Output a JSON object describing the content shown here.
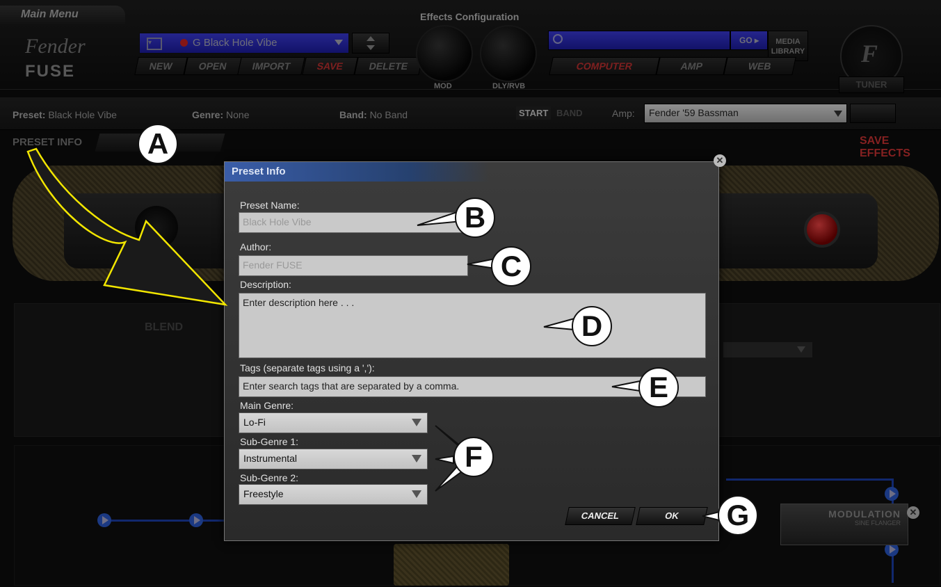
{
  "header": {
    "main_menu": "Main Menu",
    "logo_script": "Fender",
    "logo_word": "FUSE",
    "preset_select": "G Black Hole Vibe",
    "buttons": [
      "NEW",
      "OPEN",
      "IMPORT",
      "SAVE",
      "DELETE"
    ],
    "effects_title": "Effects Configuration",
    "knobs": [
      "MOD",
      "DLY/RVB"
    ],
    "go_label": "GO",
    "media_library": "MEDIA LIBRARY",
    "sources": [
      "COMPUTER",
      "AMP",
      "WEB"
    ],
    "tuner": "TUNER"
  },
  "infobar": {
    "preset_label": "Preset:",
    "preset_value": "Black Hole Vibe",
    "genre_label": "Genre:",
    "genre_value": "None",
    "band_label": "Band:",
    "band_value": "No Band",
    "start": "START",
    "band_btn": "BAND",
    "amp_label": "Amp:",
    "amp_value": "Fender '59 Bassman",
    "tab_preset_info": "PRESET INFO",
    "save_effects": "SAVE EFFECTS"
  },
  "background": {
    "blend": "BLEND",
    "modulation": "MODULATION",
    "modulation_sub": "SINE FLANGER"
  },
  "dialog": {
    "title": "Preset Info",
    "preset_name_label": "Preset Name:",
    "preset_name_value": "Black Hole Vibe",
    "author_label": "Author:",
    "author_value": "Fender FUSE",
    "description_label": "Description:",
    "description_placeholder": "Enter description here . . .",
    "tags_label": "Tags (separate tags using a ','):",
    "tags_placeholder": "Enter search tags that are separated by a comma.",
    "main_genre_label": "Main Genre:",
    "main_genre_value": "Lo-Fi",
    "sub_genre1_label": "Sub-Genre 1:",
    "sub_genre1_value": "Instrumental",
    "sub_genre2_label": "Sub-Genre 2:",
    "sub_genre2_value": "Freestyle",
    "cancel": "CANCEL",
    "ok": "OK"
  },
  "callouts": [
    "A",
    "B",
    "C",
    "D",
    "E",
    "F",
    "G"
  ],
  "colors": {
    "accent_blue": "#2b3ccf",
    "save_red": "#c03030",
    "callout_arrow": "#f2e600"
  }
}
